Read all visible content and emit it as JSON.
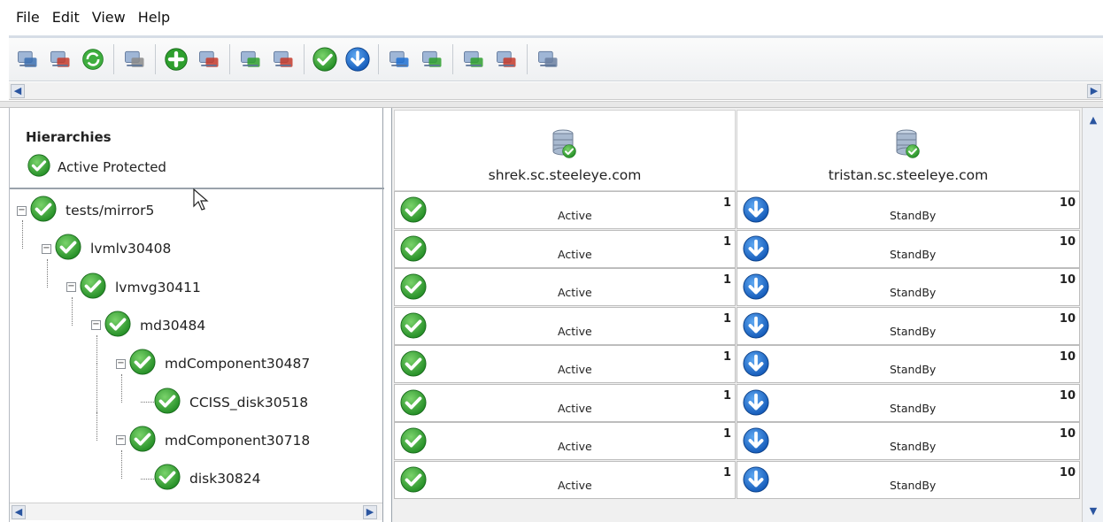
{
  "menu": [
    "File",
    "Edit",
    "View",
    "Help"
  ],
  "toolbar": {
    "groups": [
      [
        "connect-server-icon",
        "disconnect-server-icon",
        "refresh-icon"
      ],
      [
        "wizard-icon"
      ],
      [
        "create-resource-icon",
        "delete-resource-icon"
      ],
      [
        "extend-icon",
        "unextend-icon"
      ],
      [
        "in-service-icon",
        "out-of-service-icon"
      ],
      [
        "create-dependency-icon",
        "delete-dependency-icon"
      ],
      [
        "create-comm-path-icon",
        "delete-comm-path-icon"
      ],
      [
        "properties-icon"
      ]
    ]
  },
  "left_panel": {
    "title": "Hierarchies",
    "legend_label": "Active Protected",
    "tree": [
      {
        "label": "tests/mirror5",
        "level": 0
      },
      {
        "label": "lvmlv30408",
        "level": 1
      },
      {
        "label": "lvmvg30411",
        "level": 2
      },
      {
        "label": "md30484",
        "level": 3
      },
      {
        "label": "mdComponent30487",
        "level": 4
      },
      {
        "label": "CCISS_disk30518",
        "level": 5
      },
      {
        "label": "mdComponent30718",
        "level": 4
      },
      {
        "label": "disk30824",
        "level": 5
      }
    ]
  },
  "servers": [
    {
      "name": "shrek.sc.steeleye.com",
      "status": "Active",
      "priority": "1"
    },
    {
      "name": "tristan.sc.steeleye.com",
      "status": "StandBy",
      "priority": "10"
    }
  ],
  "colors": {
    "green": "#2e9f2e",
    "blue": "#1d6fd1"
  }
}
